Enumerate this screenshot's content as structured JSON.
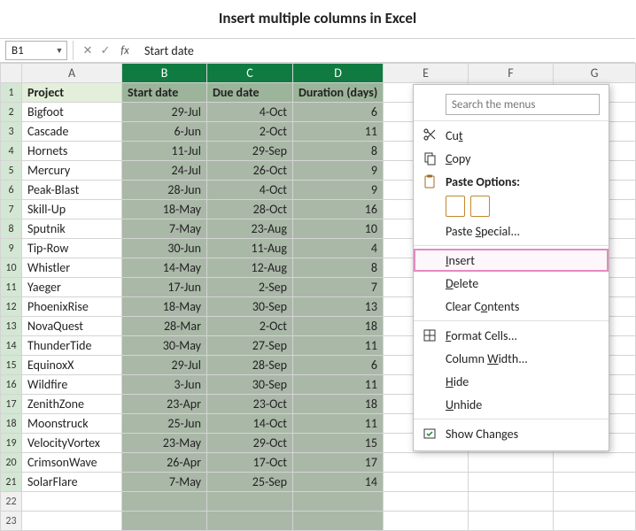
{
  "title": "Insert multiple columns in Excel",
  "name_box": "B1",
  "formula_bar": "Start date",
  "columns": [
    "A",
    "B",
    "C",
    "D",
    "E",
    "F",
    "G"
  ],
  "selected_cols": [
    "B",
    "C",
    "D"
  ],
  "headers": {
    "A": "Project",
    "B": "Start date",
    "C": "Due date",
    "D": "Duration (days)"
  },
  "rows": [
    {
      "n": 2,
      "A": "Bigfoot",
      "B": "29-Jul",
      "C": "4-Oct",
      "D": "6"
    },
    {
      "n": 3,
      "A": "Cascade",
      "B": "6-Jun",
      "C": "2-Oct",
      "D": "11"
    },
    {
      "n": 4,
      "A": "Hornets",
      "B": "11-Jul",
      "C": "29-Sep",
      "D": "8"
    },
    {
      "n": 5,
      "A": "Mercury",
      "B": "24-Jul",
      "C": "26-Oct",
      "D": "9"
    },
    {
      "n": 6,
      "A": "Peak-Blast",
      "B": "28-Jun",
      "C": "4-Oct",
      "D": "9"
    },
    {
      "n": 7,
      "A": "Skill-Up",
      "B": "18-May",
      "C": "28-Oct",
      "D": "16"
    },
    {
      "n": 8,
      "A": "Sputnik",
      "B": "7-May",
      "C": "23-Aug",
      "D": "10"
    },
    {
      "n": 9,
      "A": "Tip-Row",
      "B": "30-Jun",
      "C": "11-Aug",
      "D": "4"
    },
    {
      "n": 10,
      "A": "Whistler",
      "B": "14-May",
      "C": "12-Aug",
      "D": "8"
    },
    {
      "n": 11,
      "A": "Yaeger",
      "B": "17-Jun",
      "C": "2-Sep",
      "D": "7"
    },
    {
      "n": 12,
      "A": "PhoenixRise",
      "B": "18-May",
      "C": "30-Sep",
      "D": "13"
    },
    {
      "n": 13,
      "A": "NovaQuest",
      "B": "28-Mar",
      "C": "2-Oct",
      "D": "18"
    },
    {
      "n": 14,
      "A": "ThunderTide",
      "B": "30-May",
      "C": "27-Sep",
      "D": "11"
    },
    {
      "n": 15,
      "A": "EquinoxX",
      "B": "29-Jul",
      "C": "28-Sep",
      "D": "6"
    },
    {
      "n": 16,
      "A": "Wildfire",
      "B": "3-Jun",
      "C": "30-Sep",
      "D": "11"
    },
    {
      "n": 17,
      "A": "ZenithZone",
      "B": "23-Apr",
      "C": "23-Oct",
      "D": "18"
    },
    {
      "n": 18,
      "A": "Moonstruck",
      "B": "25-Jun",
      "C": "14-Oct",
      "D": "11"
    },
    {
      "n": 19,
      "A": "VelocityVortex",
      "B": "23-May",
      "C": "29-Oct",
      "D": "15"
    },
    {
      "n": 20,
      "A": "CrimsonWave",
      "B": "26-Apr",
      "C": "17-Oct",
      "D": "17"
    },
    {
      "n": 21,
      "A": "SolarFlare",
      "B": "7-May",
      "C": "25-Sep",
      "D": "14"
    }
  ],
  "blank_rows": [
    22,
    23
  ],
  "ctx": {
    "search_placeholder": "Search the menus",
    "cut": "Cut",
    "copy": "Copy",
    "paste_options": "Paste Options:",
    "paste_special": "Paste Special...",
    "insert": "Insert",
    "delete": "Delete",
    "clear_contents": "Clear Contents",
    "format_cells": "Format Cells...",
    "column_width": "Column Width...",
    "hide": "Hide",
    "unhide": "Unhide",
    "show_changes": "Show Changes"
  }
}
